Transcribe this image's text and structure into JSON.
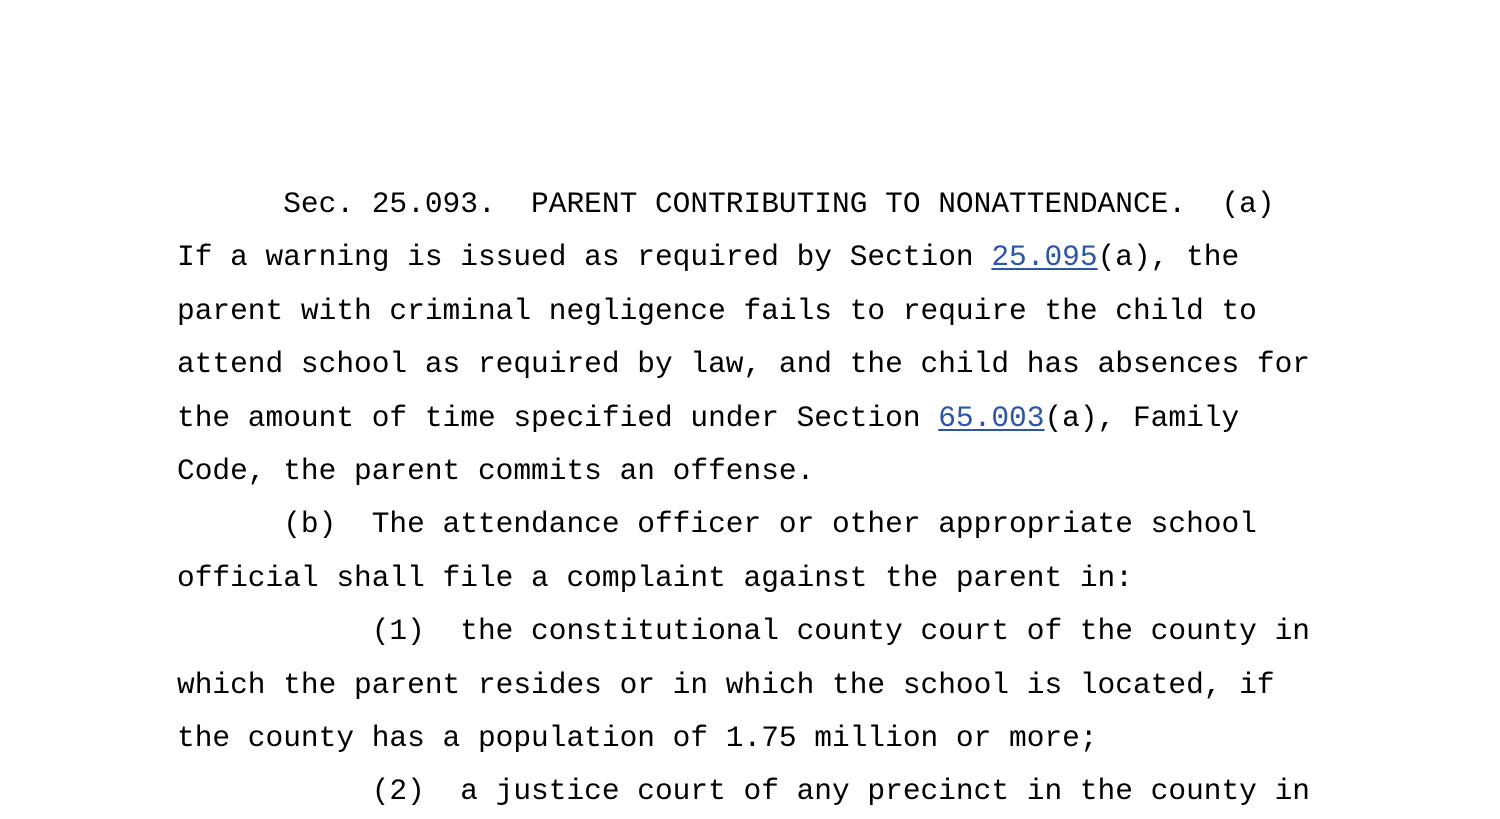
{
  "document": {
    "kind": "statute-text",
    "background_color": "#ffffff",
    "text_color": "#000000",
    "link_color": "#2b56a8",
    "section_number": "25.093",
    "section_heading": "PARENT CONTRIBUTING TO NONATTENDANCE.",
    "lines": [
      {
        "id": "line-1",
        "indent_chars": 6,
        "segments": [
          {
            "type": "text",
            "text": "Sec. 25.093.  PARENT CONTRIBUTING TO NONATTENDANCE.  (a)"
          }
        ]
      },
      {
        "id": "line-2",
        "indent_chars": 0,
        "segments": [
          {
            "type": "text",
            "text": "If a warning is issued as required by Section "
          },
          {
            "type": "link",
            "text": "25.095",
            "name": "statute-link-25-095"
          },
          {
            "type": "text",
            "text": "(a), the"
          }
        ]
      },
      {
        "id": "line-3",
        "indent_chars": 0,
        "segments": [
          {
            "type": "text",
            "text": "parent with criminal negligence fails to require the child to"
          }
        ]
      },
      {
        "id": "line-4",
        "indent_chars": 0,
        "segments": [
          {
            "type": "text",
            "text": "attend school as required by law, and the child has absences for"
          }
        ]
      },
      {
        "id": "line-5",
        "indent_chars": 0,
        "segments": [
          {
            "type": "text",
            "text": "the amount of time specified under Section "
          },
          {
            "type": "link",
            "text": "65.003",
            "name": "statute-link-65-003"
          },
          {
            "type": "text",
            "text": "(a), Family"
          }
        ]
      },
      {
        "id": "line-6",
        "indent_chars": 0,
        "segments": [
          {
            "type": "text",
            "text": "Code, the parent commits an offense."
          }
        ]
      },
      {
        "id": "line-7",
        "indent_chars": 6,
        "segments": [
          {
            "type": "text",
            "text": "(b)  The attendance officer or other appropriate school"
          }
        ]
      },
      {
        "id": "line-8",
        "indent_chars": 0,
        "segments": [
          {
            "type": "text",
            "text": "official shall file a complaint against the parent in:"
          }
        ]
      },
      {
        "id": "line-9",
        "indent_chars": 11,
        "segments": [
          {
            "type": "text",
            "text": "(1)  the constitutional county court of the county in"
          }
        ]
      },
      {
        "id": "line-10",
        "indent_chars": 0,
        "segments": [
          {
            "type": "text",
            "text": "which the parent resides or in which the school is located, if"
          }
        ]
      },
      {
        "id": "line-11",
        "indent_chars": 0,
        "segments": [
          {
            "type": "text",
            "text": "the county has a population of 1.75 million or more;"
          }
        ]
      },
      {
        "id": "line-12",
        "indent_chars": 11,
        "clipped": true,
        "segments": [
          {
            "type": "text",
            "text": "(2)  a justice court of any precinct in the county in"
          }
        ]
      }
    ]
  }
}
